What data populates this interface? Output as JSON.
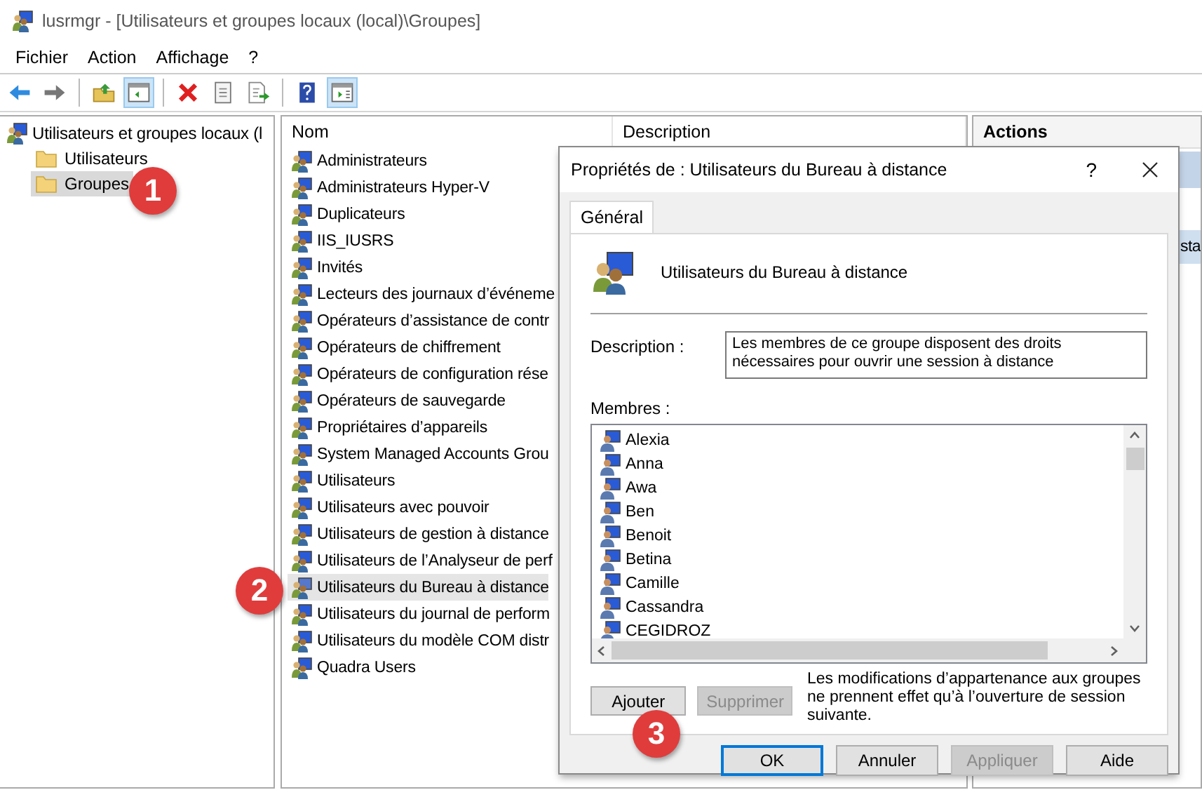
{
  "window": {
    "title": "lusrmgr - [Utilisateurs et groupes locaux (local)\\Groupes]"
  },
  "menu": [
    "Fichier",
    "Action",
    "Affichage",
    "?"
  ],
  "toolbar": [
    {
      "kind": "back",
      "pressed": false
    },
    {
      "kind": "forward",
      "pressed": false
    },
    {
      "kind": "separator"
    },
    {
      "kind": "up",
      "pressed": false
    },
    {
      "kind": "tree",
      "pressed": true
    },
    {
      "kind": "separator"
    },
    {
      "kind": "delete",
      "pressed": false
    },
    {
      "kind": "properties",
      "pressed": false
    },
    {
      "kind": "export",
      "pressed": false
    },
    {
      "kind": "separator"
    },
    {
      "kind": "help",
      "pressed": false
    },
    {
      "kind": "actionpane",
      "pressed": true
    }
  ],
  "tree": {
    "label": "Utilisateurs et groupes locaux (l",
    "children": [
      {
        "label": "Utilisateurs",
        "selected": false
      },
      {
        "label": "Groupes",
        "selected": true
      }
    ]
  },
  "list": {
    "columns": [
      "Nom",
      "Description"
    ],
    "rows": [
      {
        "name": "Administrateurs",
        "selected": false
      },
      {
        "name": "Administrateurs Hyper-V",
        "selected": false
      },
      {
        "name": "Duplicateurs",
        "selected": false
      },
      {
        "name": "IIS_IUSRS",
        "selected": false
      },
      {
        "name": "Invités",
        "selected": false
      },
      {
        "name": "Lecteurs des journaux d’événeme",
        "selected": false
      },
      {
        "name": "Opérateurs d’assistance de contr",
        "selected": false
      },
      {
        "name": "Opérateurs de chiffrement",
        "selected": false
      },
      {
        "name": "Opérateurs de configuration rése",
        "selected": false
      },
      {
        "name": "Opérateurs de sauvegarde",
        "selected": false
      },
      {
        "name": "Propriétaires d’appareils",
        "selected": false
      },
      {
        "name": "System Managed Accounts Grou",
        "selected": false
      },
      {
        "name": "Utilisateurs",
        "selected": false
      },
      {
        "name": "Utilisateurs avec pouvoir",
        "selected": false
      },
      {
        "name": "Utilisateurs de gestion à distance",
        "selected": false
      },
      {
        "name": "Utilisateurs de l’Analyseur de perf",
        "selected": false
      },
      {
        "name": "Utilisateurs du Bureau à distance",
        "selected": true
      },
      {
        "name": "Utilisateurs du journal de perform",
        "selected": false
      },
      {
        "name": "Utilisateurs du modèle COM distr",
        "selected": false
      },
      {
        "name": "Quadra Users",
        "selected": false
      }
    ]
  },
  "actions": {
    "title": "Actions",
    "items": [
      {
        "label": "sta",
        "selected": true
      }
    ]
  },
  "dialog": {
    "title": "Propriétés de : Utilisateurs du Bureau à distance",
    "help": "?",
    "tabs": [
      {
        "label": "Général",
        "selected": true
      }
    ],
    "group_name": "Utilisateurs du Bureau à distance",
    "description_label": "Description :",
    "description": "Les membres de ce groupe disposent des droits nécessaires pour ouvrir une session à distance",
    "members_label": "Membres :",
    "members": [
      "Alexia",
      "Anna",
      "Awa",
      "Ben",
      "Benoit",
      "Betina",
      "Camille",
      "Cassandra",
      "CEGIDROZ"
    ],
    "member_buttons": [
      {
        "label": "Ajouter",
        "disabled": false
      },
      {
        "label": "Supprimer",
        "disabled": true
      }
    ],
    "note": "Les modifications d’appartenance aux groupes ne prennent effet qu’à l’ouverture de session suivante.",
    "buttons": [
      {
        "label": "OK",
        "default": true,
        "disabled": false
      },
      {
        "label": "Annuler",
        "default": false,
        "disabled": false
      },
      {
        "label": "Appliquer",
        "default": false,
        "disabled": true
      },
      {
        "label": "Aide",
        "default": false,
        "disabled": false
      }
    ]
  },
  "badges": [
    "1",
    "2",
    "3"
  ]
}
